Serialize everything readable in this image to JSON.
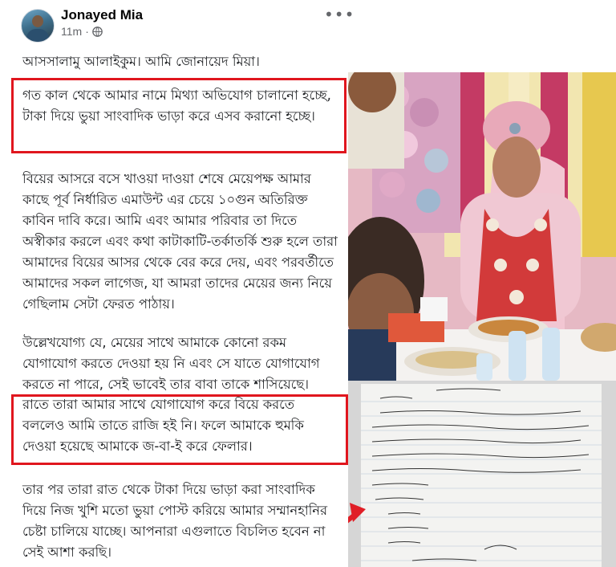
{
  "header": {
    "author": "Jonayed Mia",
    "time": "11m",
    "privacy_icon": "globe-icon",
    "more_icon": "more-options-icon"
  },
  "post": {
    "paragraphs": [
      "আসসালামু আলাইকুম। আমি জোনায়েদ মিয়া।",
      "গত কাল থেকে আমার নামে মিথ্যা অভিযোগ চালানো হচ্ছে, টাকা দিয়ে ভুয়া সাংবাদিক ভাড়া করে এসব করানো হচ্ছে।",
      "বিয়ের আসরে বসে খাওয়া দাওয়া শেষে মেয়েপক্ষ আমার কাছে পূর্ব নির্ধারিত এমাউন্ট এর চেয়ে ১০গুন অতিরিক্ত কাবিন দাবি করে। আমি এবং আমার পরিবার তা দিতে অস্বীকার করলে এবং কথা কাটাকাটি-তর্কাতর্কি শুরু হলে তারা আমাদের বিয়ের আসর থেকে বের করে দেয়, এবং পরবর্তীতে আমাদের সকল লাগেজ, যা আমরা তাদের মেয়ের জন্য নিয়ে গেছিলাম সেটা ফেরত পাঠায়।",
      "উল্লেখযোগ্য যে, মেয়ের সাথে আমাকে কোনো রকম যোগাযোগ করতে দেওয়া হয় নি এবং সে যাতে যোগাযোগ করতে না পারে, সেই ভাবেই তার বাবা তাকে শাসিয়েছে।",
      "রাতে তারা আমার সাথে যোগাযোগ করে বিয়ে করতে বললেও আমি তাতে রাজি হই নি। ফলে আমাকে হুমকি দেওয়া হয়েছে আমাকে জ-বা-ই করে ফেলার।",
      "তার পর তারা রাত থেকে টাকা দিয়ে ভাড়া করা সাংবাদিক দিয়ে নিজ খুশি মতো ভুয়া পোস্ট করিয়ে আমার সম্মানহানির চেষ্টা চালিয়ে যাচ্ছে। আপনারা এগুলাতে বিচলিত হবেন না সেই আশা করছি।"
    ]
  },
  "colors": {
    "highlight": "#e0161e",
    "secondary_text": "#65676b"
  }
}
